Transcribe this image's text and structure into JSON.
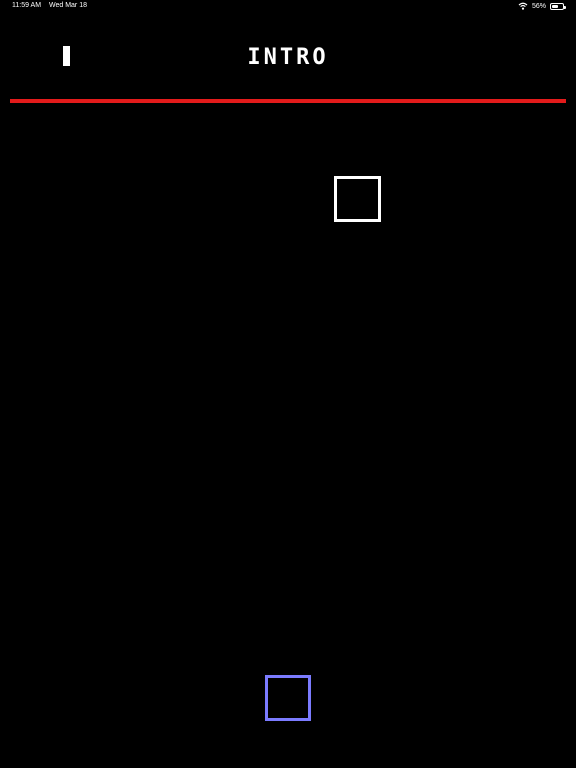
{
  "status_bar": {
    "time": "11:59 AM",
    "date": "Wed Mar 18",
    "battery_percent": "56%",
    "battery_level": 0.56,
    "wifi_icon": "wifi-icon",
    "battery_icon": "battery-icon"
  },
  "hud": {
    "pause_icon": "pause-icon",
    "level_title": "INTRO"
  },
  "colors": {
    "background": "#000000",
    "divider": "#e31b1b",
    "target_outline": "#ffffff",
    "player_outline": "#7b7bff"
  }
}
